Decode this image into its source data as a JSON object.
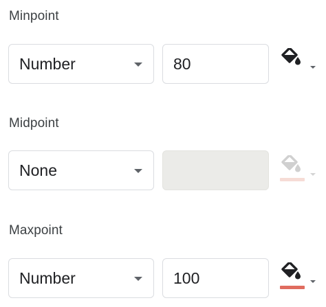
{
  "minpoint": {
    "label": "Minpoint",
    "type_select": {
      "selected": "Number"
    },
    "value": "80",
    "color_picker": {
      "icon": "fill-color-icon",
      "swatch_color": null
    }
  },
  "midpoint": {
    "label": "Midpoint",
    "type_select": {
      "selected": "None"
    },
    "value": "",
    "disabled": true,
    "color_picker": {
      "icon": "fill-color-icon",
      "swatch_color": "#f6dcd6"
    }
  },
  "maxpoint": {
    "label": "Maxpoint",
    "type_select": {
      "selected": "Number"
    },
    "value": "100",
    "color_picker": {
      "icon": "fill-color-icon",
      "swatch_color": "#e06c5f"
    }
  },
  "colors": {
    "icon_active": "#202124",
    "icon_disabled": "#d0d0d0",
    "disabled_field_bg": "#ebebe8",
    "border": "#dadce0"
  }
}
